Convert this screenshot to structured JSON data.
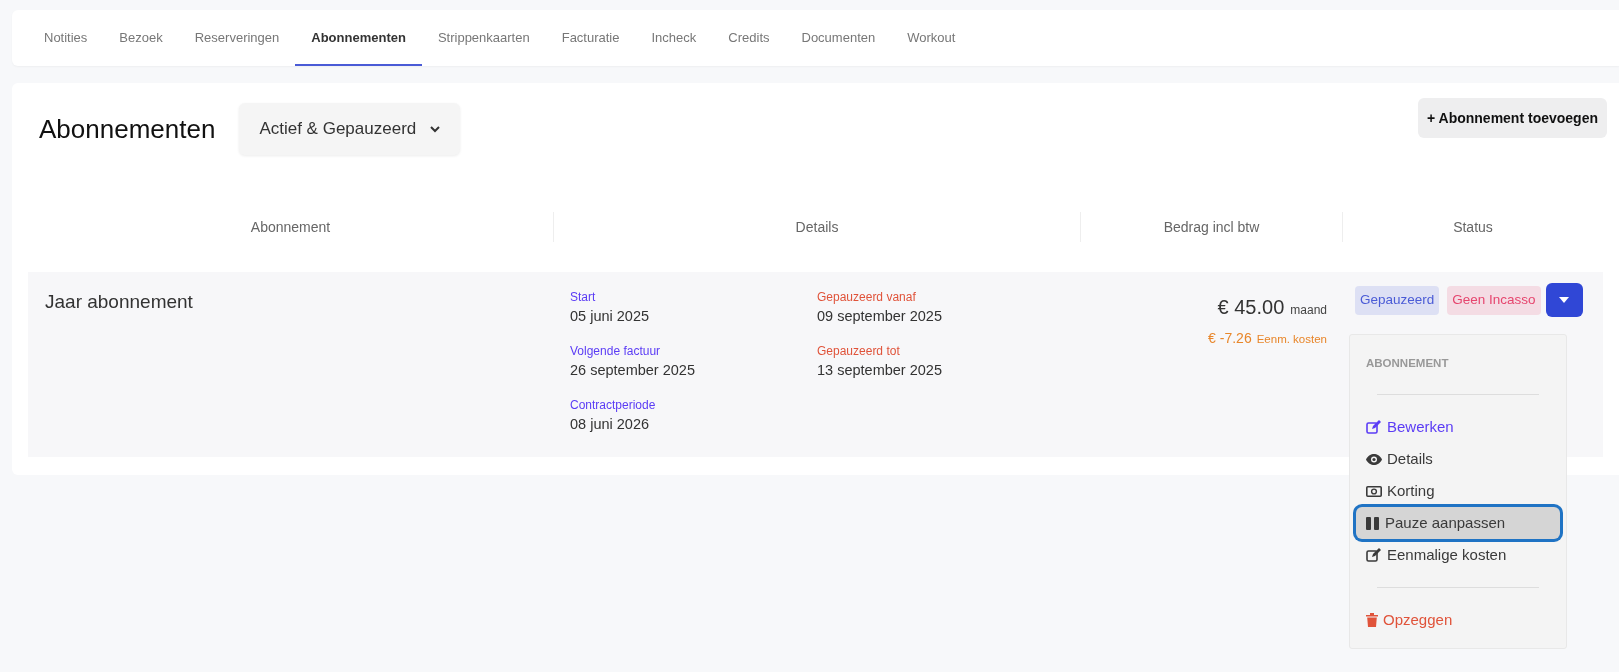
{
  "tabs": [
    {
      "label": "Notities",
      "selected": false
    },
    {
      "label": "Bezoek",
      "selected": false
    },
    {
      "label": "Reserveringen",
      "selected": false
    },
    {
      "label": "Abonnementen",
      "selected": true
    },
    {
      "label": "Strippenkaarten",
      "selected": false
    },
    {
      "label": "Facturatie",
      "selected": false
    },
    {
      "label": "Incheck",
      "selected": false
    },
    {
      "label": "Credits",
      "selected": false
    },
    {
      "label": "Documenten",
      "selected": false
    },
    {
      "label": "Workout",
      "selected": false
    }
  ],
  "header": {
    "title": "Abonnementen",
    "filter": "Actief & Gepauzeerd",
    "add_button": "+ Abonnement toevoegen"
  },
  "table": {
    "columns": [
      "Abonnement",
      "Details",
      "Bedrag incl btw",
      "Status"
    ],
    "rows": [
      {
        "name": "Jaar abonnement",
        "details": [
          [
            {
              "label": "Start",
              "value": "05 juni 2025",
              "color": "#5b3cf5"
            },
            {
              "label": "Volgende factuur",
              "value": "26 september 2025",
              "color": "#5b3cf5"
            },
            {
              "label": "Contractperiode",
              "value": "08 juni 2026",
              "color": "#5b3cf5"
            }
          ],
          [
            {
              "label": "Gepauzeerd vanaf",
              "value": "09 september 2025",
              "color": "#e0533a"
            },
            {
              "label": "Gepauzeerd tot",
              "value": "13 september 2025",
              "color": "#e0533a"
            }
          ]
        ],
        "amount": "€ 45.00",
        "period": "maand",
        "extra_amount": "€ -7.26",
        "extra_label": "Eenm. kosten",
        "badges": [
          {
            "label": "Gepauzeerd",
            "color": "#4a5bd6"
          },
          {
            "label": "Geen Incasso",
            "color": "#e6456e"
          }
        ],
        "menu": {
          "expanded": true,
          "items": [
            {
              "kind": "header",
              "label": "ABONNEMENT"
            },
            {
              "kind": "divider"
            },
            {
              "kind": "item",
              "label": "Bewerken",
              "color": "#5b3cf5",
              "selected": false
            },
            {
              "kind": "item",
              "label": "Details",
              "color": "#3a3a3a",
              "selected": false
            },
            {
              "kind": "item",
              "label": "Korting",
              "color": "#3a3a3a",
              "selected": false
            },
            {
              "kind": "item",
              "label": "Pauze aanpassen",
              "color": "#3a3a3a",
              "selected": true
            },
            {
              "kind": "item",
              "label": "Eenmalige kosten",
              "color": "#3a3a3a",
              "selected": false
            },
            {
              "kind": "divider"
            },
            {
              "kind": "item",
              "label": "Opzeggen",
              "color": "#e0533a",
              "selected": false
            }
          ]
        }
      }
    ]
  }
}
